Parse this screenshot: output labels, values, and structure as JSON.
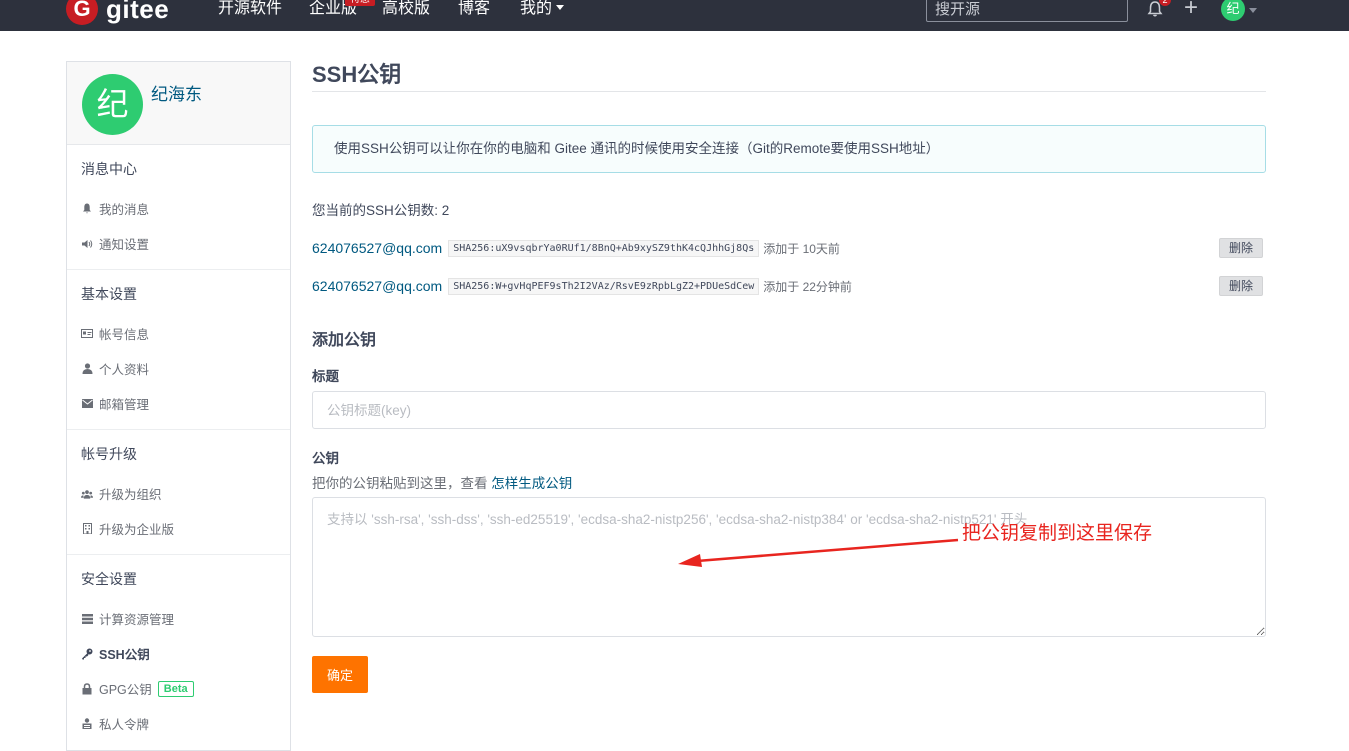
{
  "nav": {
    "logo_mark": "G",
    "logo_text": "gitee",
    "items": [
      {
        "label": "开源软件"
      },
      {
        "label": "企业版"
      },
      {
        "label": "高校版"
      },
      {
        "label": "博客"
      },
      {
        "label": "我的"
      }
    ],
    "badge": "特惠",
    "search_placeholder": "搜开源",
    "notification_count": "2",
    "avatar_text": "纪"
  },
  "sidebar": {
    "avatar_text": "纪",
    "username": "纪海东",
    "groups": [
      {
        "title": "消息中心",
        "items": [
          {
            "icon": "bell-icon",
            "label": "我的消息"
          },
          {
            "icon": "speaker-icon",
            "label": "通知设置"
          }
        ]
      },
      {
        "title": "基本设置",
        "items": [
          {
            "icon": "id-card-icon",
            "label": "帐号信息"
          },
          {
            "icon": "user-icon",
            "label": "个人资料"
          },
          {
            "icon": "mail-icon",
            "label": "邮箱管理"
          }
        ]
      },
      {
        "title": "帐号升级",
        "items": [
          {
            "icon": "group-icon",
            "label": "升级为组织"
          },
          {
            "icon": "building-icon",
            "label": "升级为企业版"
          }
        ]
      },
      {
        "title": "安全设置",
        "items": [
          {
            "icon": "server-icon",
            "label": "计算资源管理"
          },
          {
            "icon": "key-icon",
            "label": "SSH公钥"
          },
          {
            "icon": "lock-icon",
            "label": "GPG公钥",
            "badge": "Beta"
          },
          {
            "icon": "token-icon",
            "label": "私人令牌"
          }
        ]
      }
    ]
  },
  "main": {
    "title": "SSH公钥",
    "info": "使用SSH公钥可以让你在你的电脑和 Gitee 通讯的时候使用安全连接（Git的Remote要使用SSH地址）",
    "key_count": "您当前的SSH公钥数: 2",
    "keys": [
      {
        "email": "624076527@qq.com",
        "fingerprint": "SHA256:uX9vsqbrYa0RUf1/8BnQ+Ab9xySZ9thK4cQJhhGj8Qs",
        "time": "添加于 10天前",
        "delete_label": "删除"
      },
      {
        "email": "624076527@qq.com",
        "fingerprint": "SHA256:W+gvHqPEF9sTh2I2VAz/RsvE9zRpbLgZ2+PDUeSdCew",
        "time": "添加于 22分钟前",
        "delete_label": "删除"
      }
    ],
    "add_title": "添加公钥",
    "title_label": "标题",
    "title_placeholder": "公钥标题(key)",
    "key_label": "公钥",
    "key_help": "把你的公钥粘贴到这里，查看",
    "key_help_link": "怎样生成公钥",
    "key_placeholder": "支持以 'ssh-rsa', 'ssh-dss', 'ssh-ed25519', 'ecdsa-sha2-nistp256', 'ecdsa-sha2-nistp384' or 'ecdsa-sha2-nistp521' 开头",
    "submit_label": "确定"
  },
  "annotation": {
    "text": "把公钥复制到这里保存",
    "color": "#e8251f"
  }
}
